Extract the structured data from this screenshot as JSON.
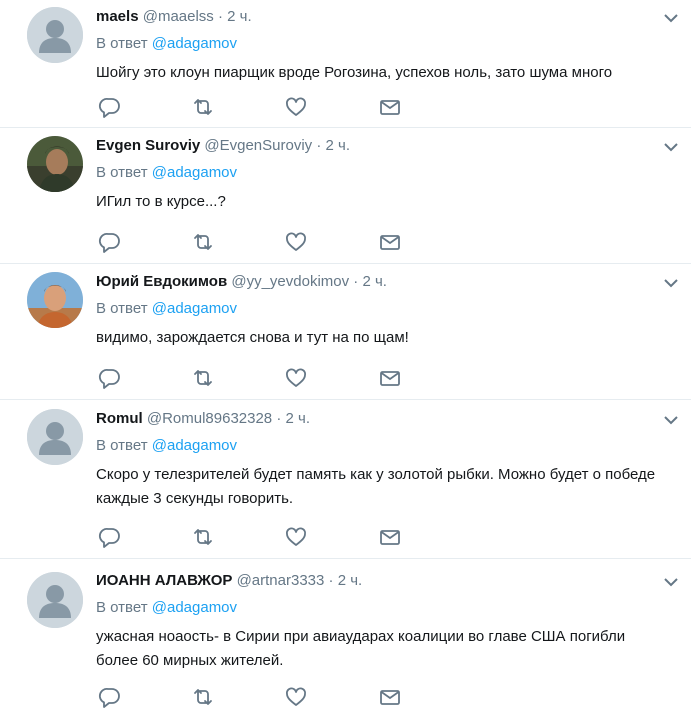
{
  "tweets": [
    {
      "name": "maels",
      "handle": "@maaelss",
      "time": "2 ч.",
      "reply_prefix": "В ответ",
      "reply_to": "@adagamov",
      "text": "Шойгу это клоун пиарщик вроде Рогозина, успехов ноль, зато шума много",
      "avatar": "default-avatar"
    },
    {
      "name": "Evgen Suroviy",
      "handle": "@EvgenSuroviy",
      "time": "2 ч.",
      "reply_prefix": "В ответ",
      "reply_to": "@adagamov",
      "text": "ИГил то в курсе...?",
      "avatar": "photo-avatar"
    },
    {
      "name": "Юрий Евдокимов",
      "handle": "@yy_yevdokimov",
      "time": "2 ч.",
      "reply_prefix": "В ответ",
      "reply_to": "@adagamov",
      "text": "видимо, зарождается снова и тут на по щам!",
      "avatar": "photo-avatar"
    },
    {
      "name": "Romul",
      "handle": "@Romul89632328",
      "time": "2 ч.",
      "reply_prefix": "В ответ",
      "reply_to": "@adagamov",
      "text": "Скоро у телезрителей будет память как у золотой рыбки. Можно будет о победе каждые 3 секунды говорить.",
      "avatar": "default-avatar"
    },
    {
      "name": "ИОАНН АЛАВЖОР",
      "handle": "@artnar3333",
      "time": "2 ч.",
      "reply_prefix": "В ответ",
      "reply_to": "@adagamov",
      "text": "ужасная ноаость- в Сирии при авиаударах коалиции во главе США погибли более 60 мирных жителей.",
      "avatar": "default-avatar"
    }
  ],
  "colors": {
    "accent": "#1da1f2",
    "muted": "#657786",
    "divider": "#e6ecf0"
  },
  "icons": {
    "reply": "reply-icon",
    "retweet": "retweet-icon",
    "like": "heart-icon",
    "dm": "envelope-icon",
    "menu": "chevron-down-icon"
  }
}
